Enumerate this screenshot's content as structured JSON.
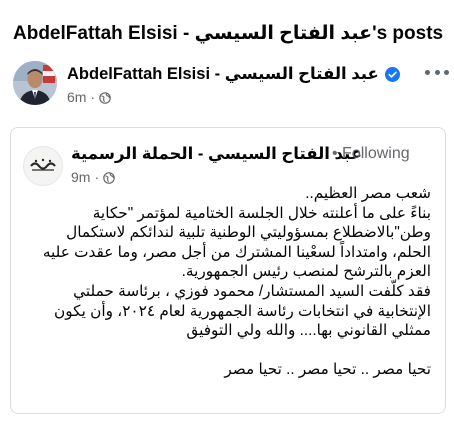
{
  "page": {
    "title": "AbdelFattah Elsisi - عبد الفتاح السيسي's posts"
  },
  "post": {
    "author_name": "AbdelFattah Elsisi - عبد  الفتاح  السيسي",
    "time": "6m",
    "separator": "·",
    "audience_icon": "globe-icon",
    "verified_icon": "verified-badge-icon",
    "more_icon": "more-options-icon",
    "accent_color": "#1877f2"
  },
  "shared_post": {
    "page_name": "عبد الفتاح السيسي - الحملة الرسمية",
    "follow_label": "• Following",
    "time": "9m",
    "separator": "·",
    "audience_icon": "globe-icon",
    "avatar_icon": "campaign-logo-icon",
    "body_lines": [
      "شعب مصر العظيم..",
      "بناءً على ما أعلنته خلال الجلسة الختامية لمؤتمر \"حكاية",
      "وطن\"بالاضطلاع بمسؤوليتي الوطنية تلبية لندائكم لاستكمال",
      "الحلم، وامتداداً لسعْينا المشترك من أجل مصر، وما عقدت عليه",
      "العزم بالترشح لمنصب رئيس الجمهورية.",
      "فقد كلّفت السيد المستشار/ محمود فوزي ، برئاسة حملتي",
      "الإنتخابية في انتخابات رئاسة الجمهورية لعام ٢٠٢٤، وأن يكون",
      "ممثلي القانوني بها.... والله ولي التوفيق",
      "",
      "تحيا مصر .. تحيا مصر .. تحيا مصر"
    ]
  }
}
